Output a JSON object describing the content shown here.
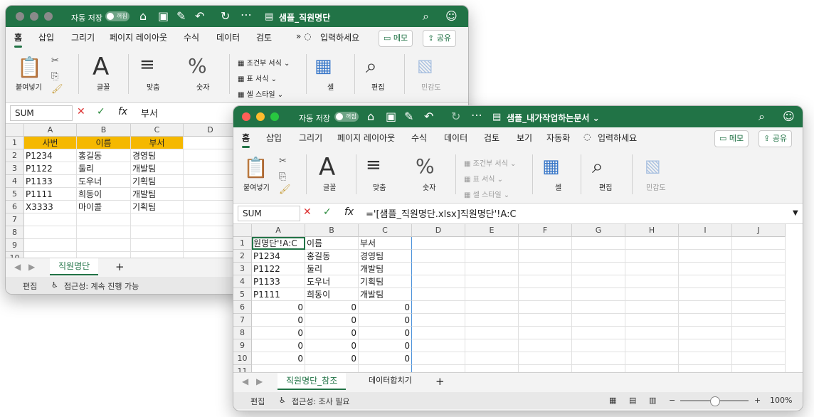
{
  "back_window": {
    "autosave_label": "자동 저장",
    "autosave_state": "꺼짐",
    "file_title": "샘플_직원명단",
    "tabs": [
      "홈",
      "삽입",
      "그리기",
      "페이지 레이아웃",
      "수식",
      "데이터",
      "검토"
    ],
    "tell_me": "입력하세요",
    "memo_label": "메모",
    "share_label": "공유",
    "ribbon": {
      "paste": "붙여넣기",
      "font": "글꼴",
      "align": "맞춤",
      "number": "숫자",
      "cond_format": "조건부 서식",
      "table_format": "표 서식",
      "cell_style": "셀 스타일",
      "cells": "셀",
      "edit": "편집",
      "sensitivity": "민감도"
    },
    "name_box": "SUM",
    "formula": "부서",
    "columns": [
      "A",
      "B",
      "C",
      "D"
    ],
    "rows": [
      [
        "사번",
        "이름",
        "부서",
        ""
      ],
      [
        "P1234",
        "홍길동",
        "경영팀",
        ""
      ],
      [
        "P1122",
        "둘리",
        "개발팀",
        ""
      ],
      [
        "P1133",
        "도우너",
        "기획팀",
        ""
      ],
      [
        "P1111",
        "희동이",
        "개발팀",
        ""
      ],
      [
        "X3333",
        "마이콜",
        "기획팀",
        ""
      ],
      [
        "",
        "",
        "",
        ""
      ],
      [
        "",
        "",
        "",
        ""
      ],
      [
        "",
        "",
        "",
        ""
      ]
    ],
    "header_fill": "#F5B800",
    "sheet_tab": "직원명단",
    "status_mode": "편집",
    "status_accessibility": "접근성: 계속 진행 가능"
  },
  "front_window": {
    "autosave_label": "자동 저장",
    "autosave_state": "꺼짐",
    "file_title": "샘플_내가작업하는문서",
    "tabs": [
      "홈",
      "삽입",
      "그리기",
      "페이지 레이아웃",
      "수식",
      "데이터",
      "검토",
      "보기",
      "자동화"
    ],
    "tell_me": "입력하세요",
    "memo_label": "메모",
    "share_label": "공유",
    "ribbon": {
      "paste": "붙여넣기",
      "font": "글꼴",
      "align": "맞춤",
      "number": "숫자",
      "cond_format": "조건부 서식",
      "table_format": "표 서식",
      "cell_style": "셀 스타일",
      "cells": "셀",
      "edit": "편집",
      "sensitivity": "민감도"
    },
    "name_box": "SUM",
    "formula": "='[샘플_직원명단.xlsx]직원명단'!A:C",
    "columns": [
      "A",
      "B",
      "C",
      "D",
      "E",
      "F",
      "G",
      "H",
      "I",
      "J"
    ],
    "rows": [
      [
        "원명단'!A:C",
        "이름",
        "부서"
      ],
      [
        "P1234",
        "홍길동",
        "경영팀"
      ],
      [
        "P1122",
        "둘리",
        "개발팀"
      ],
      [
        "P1133",
        "도우너",
        "기획팀"
      ],
      [
        "P1111",
        "희동이",
        "개발팀"
      ],
      [
        "0",
        "0",
        "0"
      ],
      [
        "0",
        "0",
        "0"
      ],
      [
        "0",
        "0",
        "0"
      ],
      [
        "0",
        "0",
        "0"
      ],
      [
        "0",
        "0",
        "0"
      ],
      [
        "",
        "",
        ""
      ]
    ],
    "sheet_tabs": [
      "직원명단_참조",
      "데이터합치기"
    ],
    "status_mode": "편집",
    "status_accessibility": "접근성: 조사 필요",
    "zoom": "100%"
  },
  "colors": {
    "excel_green": "#217346",
    "tab_bar": "#f3f3f3",
    "header_fill": "#F5B800"
  }
}
